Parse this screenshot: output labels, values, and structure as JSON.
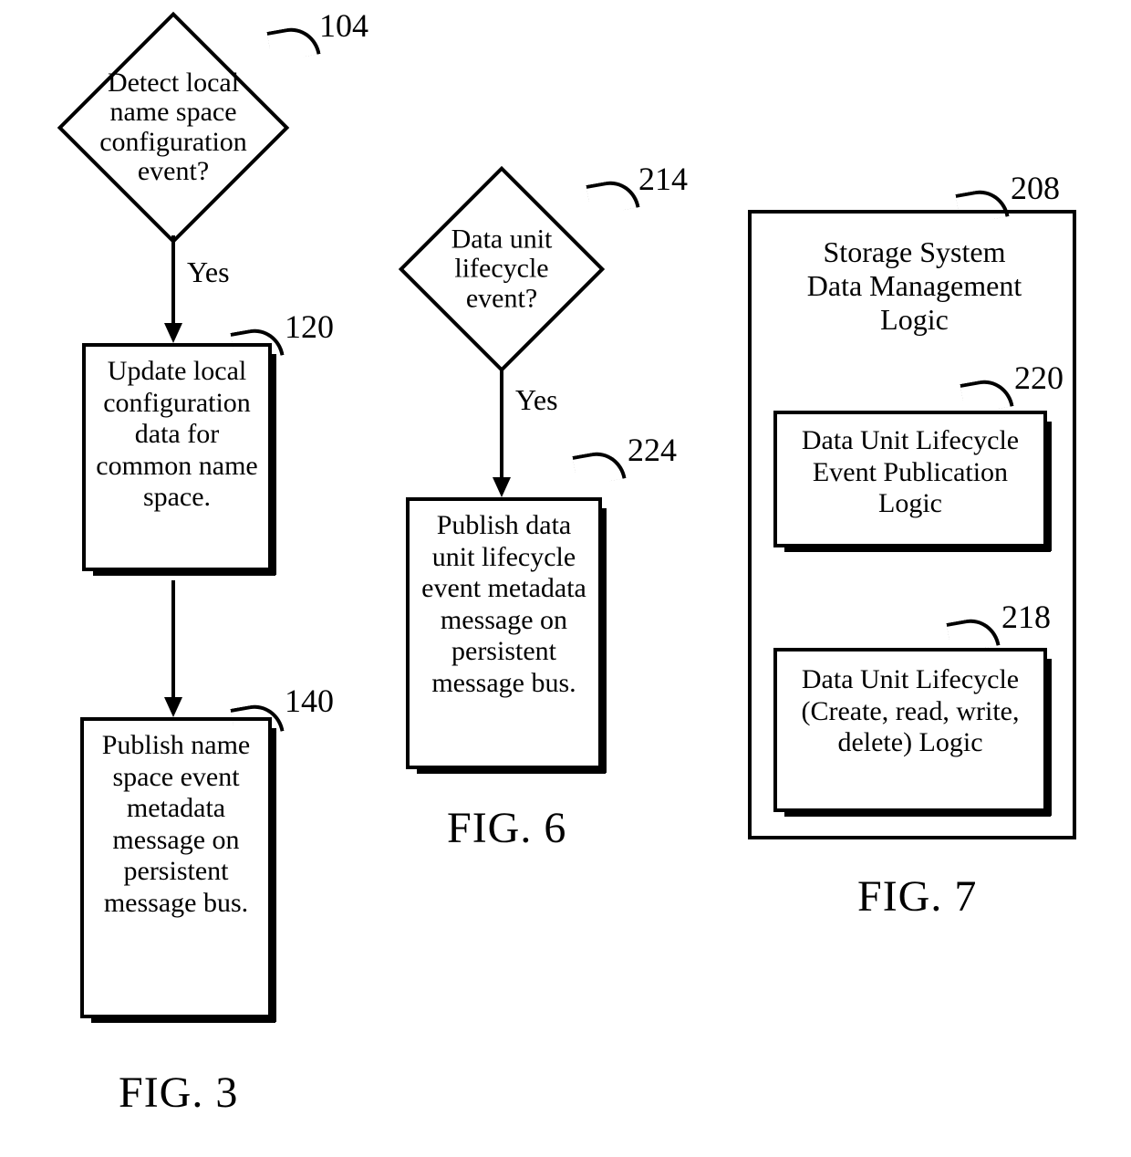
{
  "fig3": {
    "caption": "FIG. 3",
    "n104": {
      "ref": "104",
      "text": "Detect local name space configuration event?"
    },
    "yes1": "Yes",
    "n120": {
      "ref": "120",
      "text": "Update local configuration data for common name space."
    },
    "n140": {
      "ref": "140",
      "text": "Publish name space event metadata message on persistent message bus."
    }
  },
  "fig6": {
    "caption": "FIG. 6",
    "n214": {
      "ref": "214",
      "text": "Data unit lifecycle event?"
    },
    "yes2": "Yes",
    "n224": {
      "ref": "224",
      "text": "Publish data unit lifecycle event metadata message on persistent message bus."
    }
  },
  "fig7": {
    "caption": "FIG. 7",
    "n208": {
      "ref": "208",
      "text": "Storage System Data Management Logic"
    },
    "n220": {
      "ref": "220",
      "text": "Data  Unit  Lifecycle Event Publication Logic"
    },
    "n218": {
      "ref": "218",
      "text": "Data Unit Lifecycle (Create, read, write, delete) Logic"
    }
  }
}
